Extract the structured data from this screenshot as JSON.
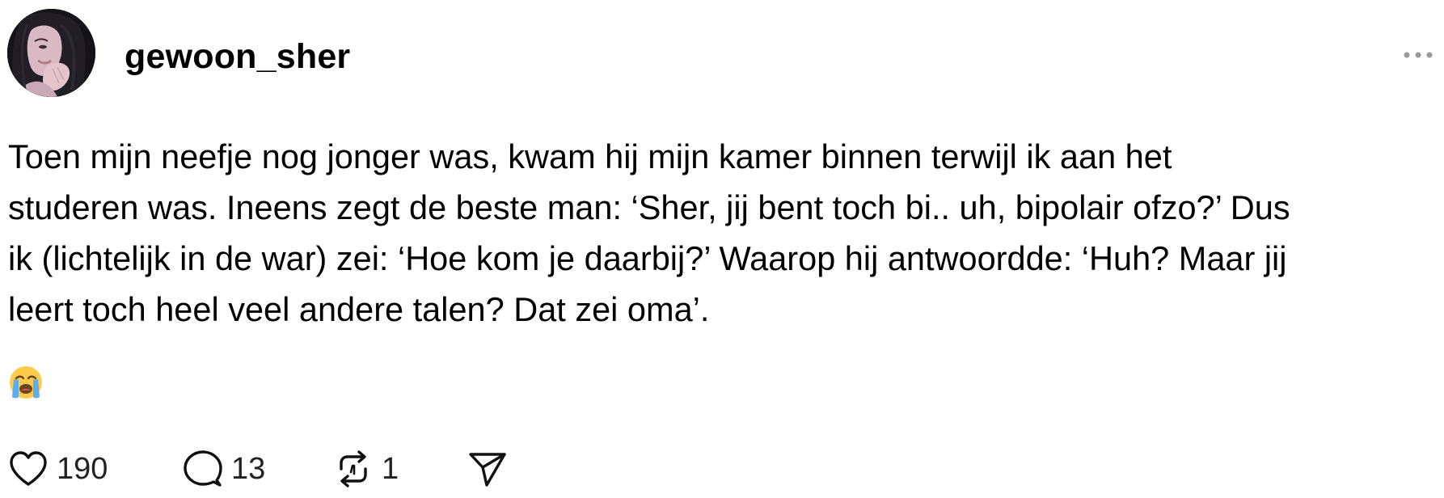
{
  "post": {
    "username": "gewoon_sher",
    "text": "Toen mijn neefje nog jonger was, kwam hij mijn kamer binnen terwijl ik aan het\nstuderen was. Ineens zegt de beste man: ‘Sher, jij bent toch bi.. uh, bipolair ofzo?’ Dus\nik (lichtelijk in de war) zei: ‘Hoe kom je daarbij?’ Waarop hij antwoordde: ‘Huh? Maar jij\nleert toch heel veel andere talen? Dat zei oma’.",
    "emoji": "loudly-crying-face",
    "more_icon": "more-horizontal-icon"
  },
  "actions": {
    "likes": {
      "icon": "heart-icon",
      "count": "190"
    },
    "replies": {
      "icon": "comment-icon",
      "count": "13"
    },
    "reposts": {
      "icon": "repost-icon",
      "count": "1"
    },
    "share": {
      "icon": "send-icon"
    }
  },
  "colors": {
    "text": "#000000",
    "muted": "#999999",
    "icon": "#000000",
    "emoji_face": "#FFCB4C",
    "tears": "#5DADEC"
  }
}
